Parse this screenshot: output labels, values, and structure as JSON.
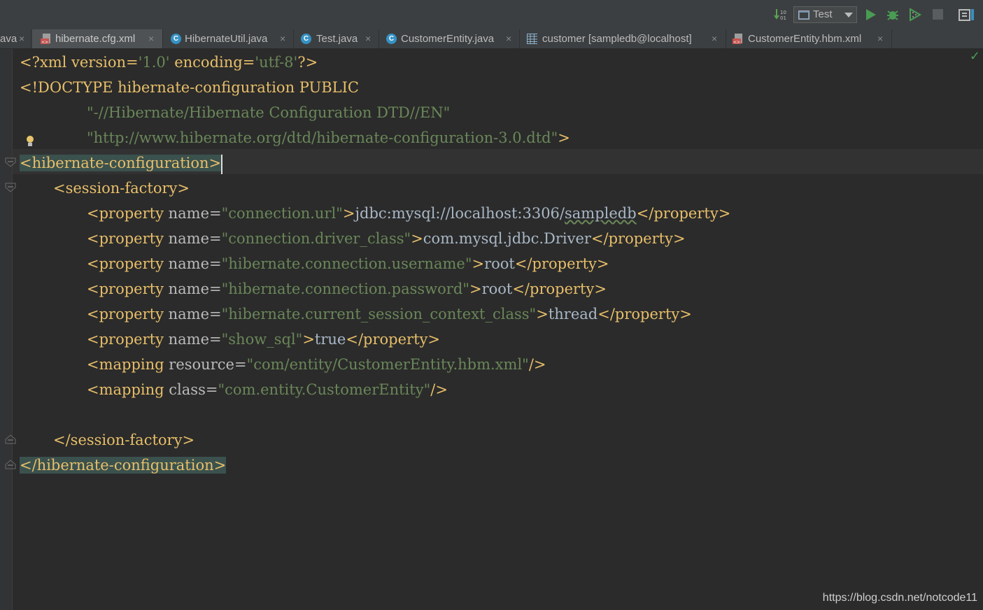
{
  "toolbar": {
    "run_config_label": "Test",
    "icons": [
      "sort-icon",
      "run-config-icon",
      "dropdown-icon",
      "run-icon",
      "debug-icon",
      "coverage-icon",
      "stop-icon",
      "project-structure-icon"
    ]
  },
  "tabs": [
    {
      "label": "ava",
      "icon": "partial-tab",
      "active": false
    },
    {
      "label": "hibernate.cfg.xml",
      "icon": "xml-file-icon",
      "active": true
    },
    {
      "label": "HibernateUtil.java",
      "icon": "class-icon",
      "active": false
    },
    {
      "label": "Test.java",
      "icon": "class-run-icon",
      "active": false
    },
    {
      "label": "CustomerEntity.java",
      "icon": "class-icon",
      "active": false
    },
    {
      "label": "customer [sampledb@localhost]",
      "icon": "table-icon",
      "active": false
    },
    {
      "label": "CustomerEntity.hbm.xml",
      "icon": "xml-file-icon",
      "active": false
    }
  ],
  "tab_close": "×",
  "code": {
    "l1": {
      "a": "<?xml version=",
      "b": "'1.0'",
      "c": " encoding=",
      "d": "'utf-8'",
      "e": "?>"
    },
    "l2": {
      "a": "<!DOCTYPE hibernate-configuration PUBLIC"
    },
    "l3": {
      "a": "\"-//Hibernate/Hibernate Configuration DTD//EN\""
    },
    "l4": {
      "a": "\"http://www.hibernate.org/dtd/hibernate-configuration-3.0.dtd\"",
      "b": ">"
    },
    "l5": {
      "a": "<hibernate-configuration>"
    },
    "l6": {
      "a": "<session-factory>"
    },
    "p1": {
      "name": "connection.url",
      "value_a": "jdbc:mysql://localhost:3306/",
      "value_b": "sampledb"
    },
    "p2": {
      "name": "connection.driver_class",
      "value": "com.mysql.jdbc.Driver"
    },
    "p3": {
      "name": "hibernate.connection.username",
      "value": "root"
    },
    "p4": {
      "name": "hibernate.connection.password",
      "value": "root"
    },
    "p5": {
      "name": "hibernate.current_session_context_class",
      "value": "thread"
    },
    "p6": {
      "name": "show_sql",
      "value": "true"
    },
    "m1": {
      "attr": "resource",
      "value": "com/entity/CustomerEntity.hbm.xml"
    },
    "m2": {
      "attr": "class",
      "value": "com.entity.CustomerEntity"
    },
    "l15": {
      "a": "</session-factory>"
    },
    "l16": {
      "a": "</hibernate-configuration>"
    },
    "tags": {
      "prop_open": "<property",
      "name_attr": " name=",
      "prop_close": "</property>",
      "gt": ">",
      "mapping_open": "<mapping",
      "eq": "=",
      "self_close": "/>"
    }
  },
  "status_check": "✓",
  "watermark": "https://blog.csdn.net/notcode11"
}
